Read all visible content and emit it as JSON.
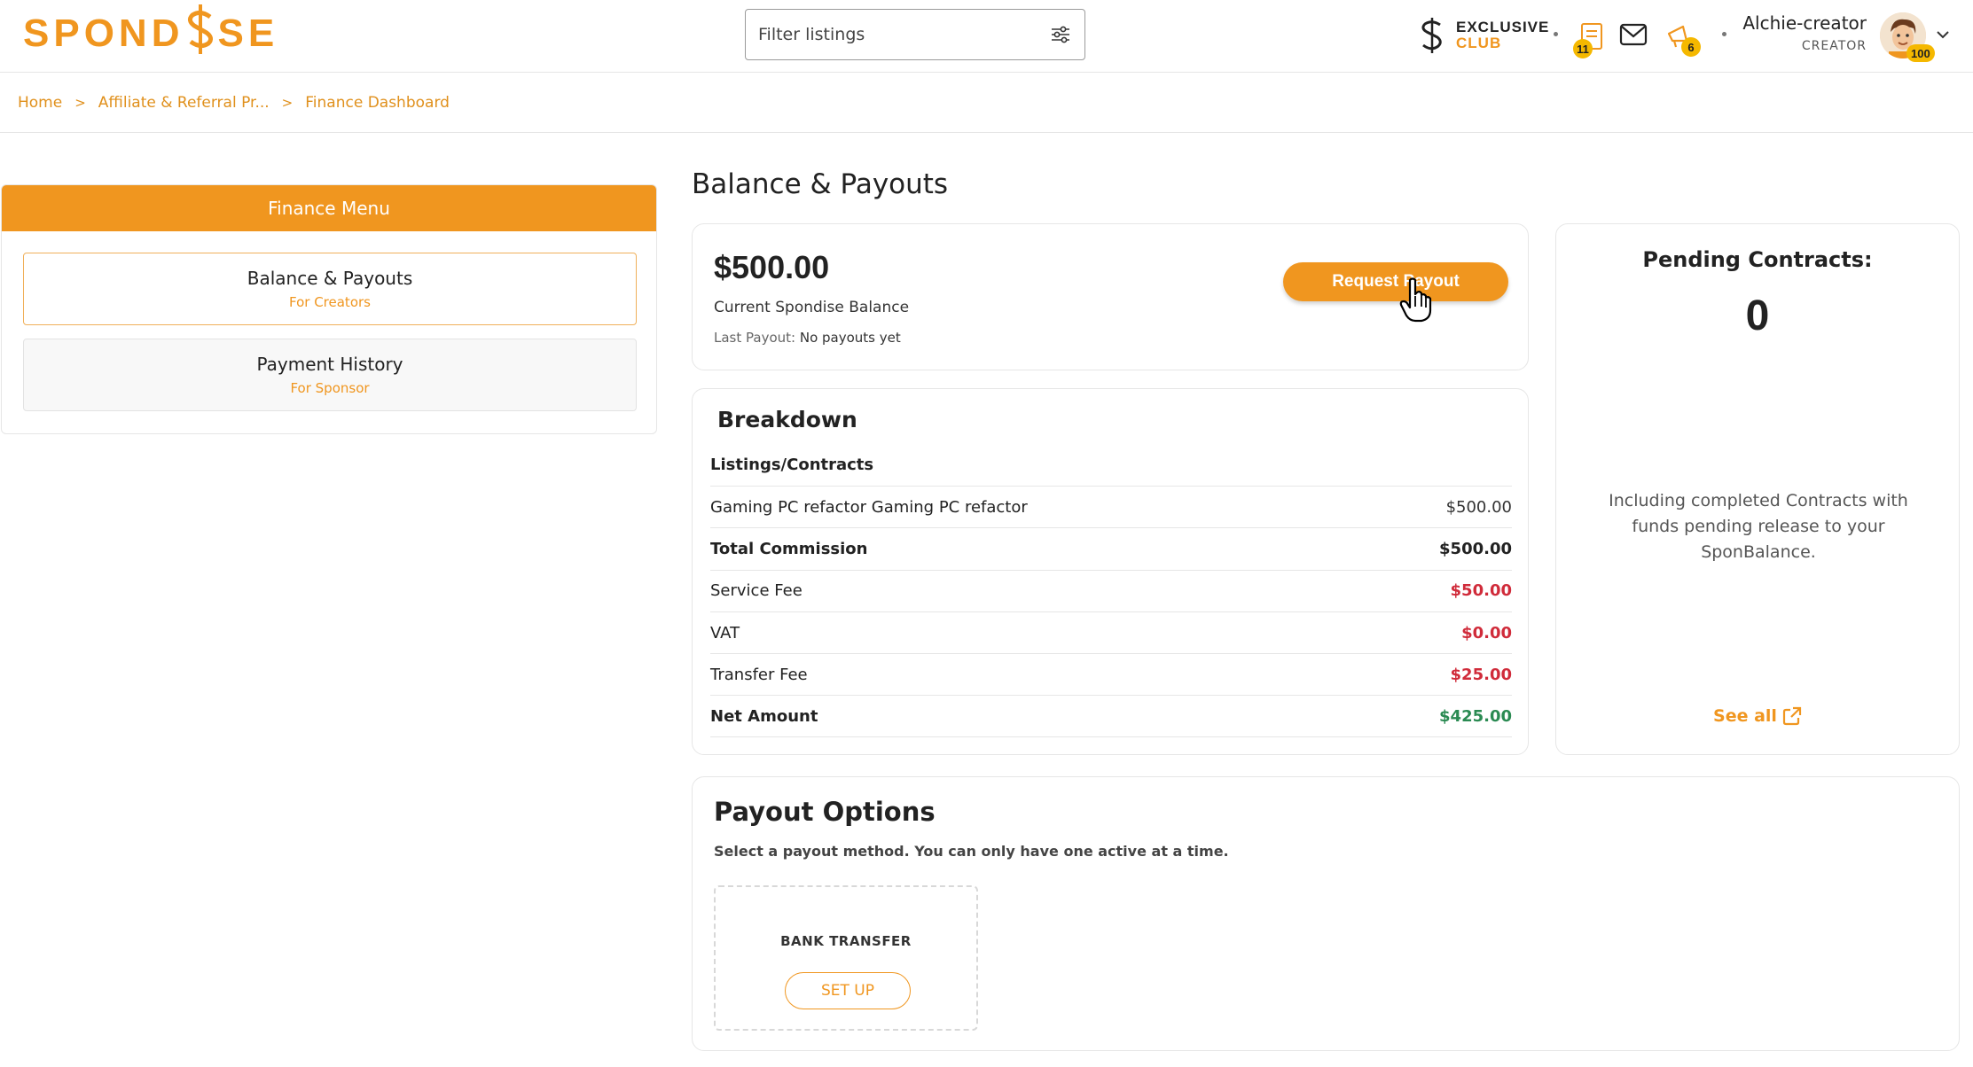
{
  "brand": {
    "logo_left": "SPOND",
    "logo_mid": "I",
    "logo_right": "SE",
    "accent_color": "#f0961f"
  },
  "header": {
    "search_placeholder": "Filter listings",
    "exclusive_line1": "EXCLUSIVE",
    "exclusive_line2": "CLUB",
    "contracts_badge": "11",
    "notifications_badge": "6",
    "user_name": "Alchie-creator",
    "user_role": "CREATOR",
    "avatar_badge": "100"
  },
  "breadcrumb": {
    "items": [
      "Home",
      "Affiliate & Referral Pr...",
      "Finance Dashboard"
    ],
    "separator": ">"
  },
  "sidebar": {
    "title": "Finance Menu",
    "items": [
      {
        "label": "Balance & Payouts",
        "sub": "For Creators",
        "active": true
      },
      {
        "label": "Payment History",
        "sub": "For Sponsor",
        "active": false
      }
    ]
  },
  "main": {
    "title": "Balance & Payouts",
    "balance": {
      "amount": "$500.00",
      "label": "Current Spondise Balance",
      "last_payout_label": "Last Payout:",
      "last_payout_value": "No payouts yet",
      "request_button": "Request Payout"
    },
    "breakdown": {
      "title": "Breakdown",
      "subheader": "Listings/Contracts",
      "rows": [
        {
          "label": "Gaming PC refactor Gaming PC refactor",
          "value": "$500.00",
          "style": "plain"
        },
        {
          "label": "Total Commission",
          "value": "$500.00",
          "style": "bold"
        },
        {
          "label": "Service Fee",
          "value": "$50.00",
          "style": "red"
        },
        {
          "label": "VAT",
          "value": "$0.00",
          "style": "red"
        },
        {
          "label": "Transfer Fee",
          "value": "$25.00",
          "style": "red"
        },
        {
          "label": "Net Amount",
          "value": "$425.00",
          "style": "green"
        }
      ]
    },
    "pending": {
      "title": "Pending Contracts:",
      "count": "0",
      "note": "Including completed Contracts with funds pending release to your SponBalance.",
      "see_all": "See all"
    },
    "payout_options": {
      "title": "Payout Options",
      "subtitle": "Select a payout method. You can only have one active at a time.",
      "options": [
        {
          "name": "BANK TRANSFER",
          "button": "SET UP"
        }
      ]
    }
  },
  "colors": {
    "red": "#d02b3a",
    "green": "#2a8a52",
    "badge": "#f5b800"
  }
}
